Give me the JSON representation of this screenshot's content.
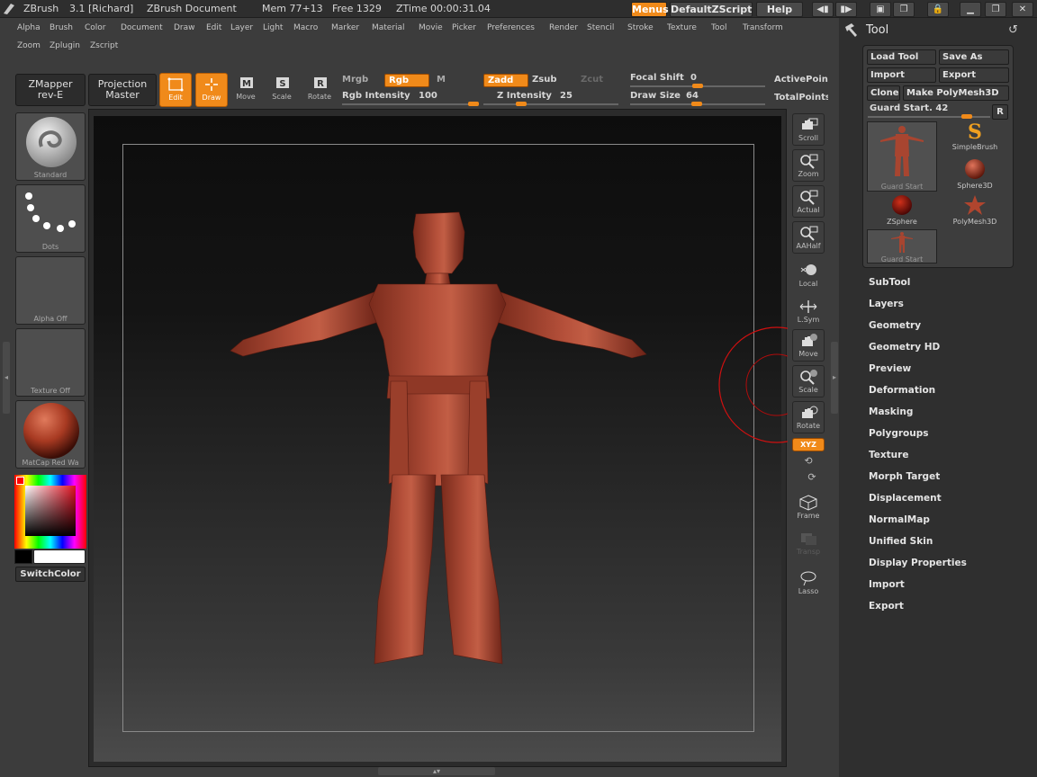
{
  "titlebar": {
    "app": "ZBrush",
    "version": "3.1 [Richard]",
    "document": "ZBrush Document",
    "mem": "Mem 77+13",
    "free": "Free 1329",
    "ztime": "ZTime 00:00:31.04",
    "menus_btn": "Menus",
    "script_btn": "DefaultZScript",
    "help_btn": "Help"
  },
  "menus": {
    "row1": [
      "Alpha",
      "Brush",
      "Color",
      "Document",
      "Draw",
      "Edit",
      "Layer",
      "Light",
      "Macro",
      "Marker",
      "Material",
      "Movie",
      "Picker",
      "Preferences",
      "Render",
      "Stencil",
      "Stroke",
      "Texture",
      "Tool",
      "Transform"
    ],
    "row2": [
      "Zoom",
      "Zplugin",
      "Zscript"
    ]
  },
  "toolbar": {
    "zmapper_line1": "ZMapper",
    "zmapper_line2": "rev-E",
    "projection_line1": "Projection",
    "projection_line2": "Master",
    "edit": "Edit",
    "draw": "Draw",
    "move": "Move",
    "scale": "Scale",
    "rotate": "Rotate",
    "mrgb": "Mrgb",
    "rgb": "Rgb",
    "m": "M",
    "rgb_intensity_label": "Rgb Intensity",
    "rgb_intensity": "100",
    "zadd": "Zadd",
    "zsub": "Zsub",
    "zcut": "Zcut",
    "z_intensity_label": "Z Intensity",
    "z_intensity": "25",
    "focal_label": "Focal Shift",
    "focal": "0",
    "draw_size_label": "Draw Size",
    "draw_size": "64",
    "active_points": "ActivePoints",
    "total_points": "TotalPoints"
  },
  "left_shelf": {
    "brush": "Standard",
    "stroke": "Dots",
    "alpha": "Alpha  Off",
    "texture": "Texture  Off",
    "material": "MatCap  Red  Wa",
    "switch_color": "SwitchColor"
  },
  "right_shelf": [
    "Scroll",
    "Zoom",
    "Actual",
    "AAHalf",
    "Local",
    "L.Sym",
    "Move",
    "Scale",
    "Rotate",
    "XYZ",
    "Frame",
    "Transp",
    "Lasso"
  ],
  "tool_panel": {
    "title": "Tool",
    "load_tool": "Load Tool",
    "save_as": "Save As",
    "import": "Import",
    "export": "Export",
    "clone": "Clone",
    "make_polymesh": "Make PolyMesh3D",
    "guard_label": "Guard Start. 42",
    "r_btn": "R",
    "thumbs": [
      "Guard Start",
      "SimpleBrush",
      "Sphere3D",
      "ZSphere",
      "PolyMesh3D",
      "Guard Start"
    ],
    "sections": [
      "SubTool",
      "Layers",
      "Geometry",
      "Geometry HD",
      "Preview",
      "Deformation",
      "Masking",
      "Polygroups",
      "Texture",
      "Morph Target",
      "Displacement",
      "NormalMap",
      "Unified Skin",
      "Display Properties",
      "Import",
      "Export"
    ]
  },
  "colors": {
    "accent": "#f08a1a",
    "model": "#a8402c",
    "background": "#3c3c3c"
  }
}
